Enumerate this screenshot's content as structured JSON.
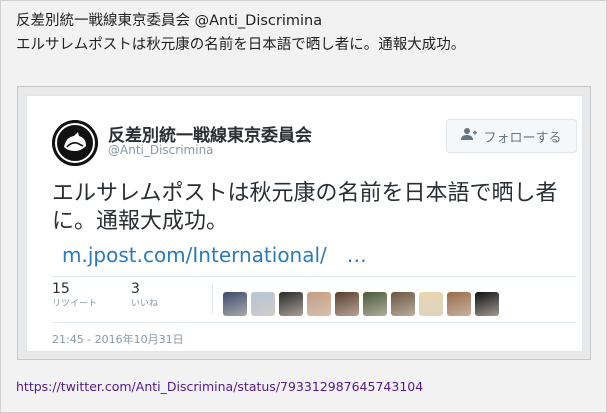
{
  "post": {
    "title": "反差別統一戦線東京委員会 @Anti_Discrimina",
    "body": "エルサレムポストは秋元康の名前を日本語で晒し者に。通報大成功。"
  },
  "tweet": {
    "account_name": "反差別統一戦線東京委員会",
    "handle": "@Anti_Discrimina",
    "follow_label": "フォローする",
    "text": "エルサレムポストは秋元康の名前を日本語で晒し者に。通報大成功。",
    "link": "m.jpost.com/International/　…",
    "retweets": {
      "count": "15",
      "label": "リツイート"
    },
    "likes": {
      "count": "3",
      "label": "いいね"
    },
    "liker_avatars": [
      "#3b4a6b",
      "#b8c4d6",
      "#2a2a2a",
      "#c79c80",
      "#5a3d2b",
      "#4a5a3a",
      "#6b5640",
      "#e8d8b0",
      "#9a6b4a",
      "#111111"
    ],
    "timestamp": "21:45 - 2016年10月31日"
  },
  "source_url": "https://twitter.com/Anti_Discrimina/status/793312987645743104",
  "colors": {
    "link": "#2b7bb9",
    "muted": "#8899a6",
    "visited": "#551a8b"
  }
}
